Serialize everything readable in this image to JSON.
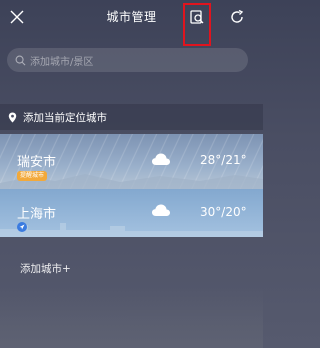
{
  "header": {
    "title": "城市管理"
  },
  "search": {
    "placeholder": "添加城市/景区"
  },
  "locate": {
    "label": "添加当前定位城市"
  },
  "cities": [
    {
      "name": "瑞安市",
      "badge": "提醒城市",
      "weather": "cloud-icon",
      "temp": "28°/21°"
    },
    {
      "name": "上海市",
      "badge_icon": "navigation-icon",
      "weather": "cloud-icon",
      "temp": "30°/20°"
    }
  ],
  "add_city": {
    "label": "添加城市+"
  },
  "colors": {
    "highlight": "#e0141e",
    "badge": "#f2a93b",
    "nav_badge": "#3a7be0"
  }
}
